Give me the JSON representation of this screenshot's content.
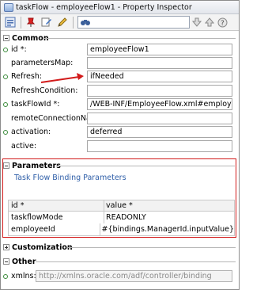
{
  "window": {
    "title": "taskFlow - employeeFlow1 - Property Inspector"
  },
  "toolbar": {
    "icons": [
      "properties-icon",
      "pin-icon",
      "edit-icon",
      "pencil-icon",
      "binoculars-icon",
      "find-next-icon",
      "find-previous-icon",
      "help-icon"
    ],
    "search_value": ""
  },
  "sections": {
    "common": {
      "label": "Common",
      "properties": [
        {
          "label": "id *:",
          "value": "employeeFlow1",
          "required": true
        },
        {
          "label": "parametersMap:",
          "value": "",
          "required": false
        },
        {
          "label": "Refresh:",
          "value": "ifNeeded",
          "required": true
        },
        {
          "label": "RefreshCondition:",
          "value": "",
          "required": false
        },
        {
          "label": "taskFlowId *:",
          "value": "/WEB-INF/EmployeeFlow.xml#employeeFlow",
          "required": true
        },
        {
          "label": "remoteConnectionName:",
          "value": "",
          "required": false
        },
        {
          "label": "activation:",
          "value": "deferred",
          "required": true
        },
        {
          "label": "active:",
          "value": "",
          "required": false
        }
      ]
    },
    "parameters": {
      "label": "Parameters",
      "subtitle": "Task Flow Binding Parameters",
      "table": {
        "headers": [
          "id *",
          "value *"
        ],
        "rows": [
          [
            "taskflowMode",
            "READONLY"
          ],
          [
            "employeeId",
            "#{bindings.ManagerId.inputValue}"
          ]
        ]
      }
    },
    "customization": {
      "label": "Customization"
    },
    "other": {
      "label": "Other",
      "xmlns_label": "xmlns:",
      "xmlns_value": "http://xmlns.oracle.com/adf/controller/binding"
    }
  },
  "colors": {
    "highlight_border": "#d21b1b",
    "link_blue": "#2e5ea8",
    "required_dot": "#3a8a3a"
  }
}
